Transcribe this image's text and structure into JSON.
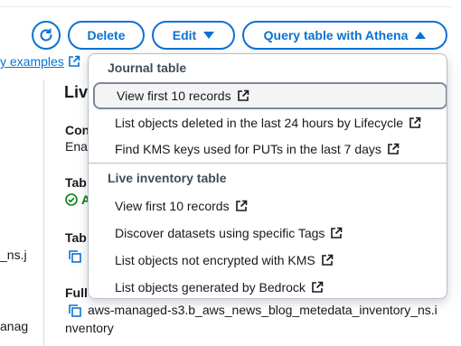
{
  "toolbar": {
    "delete_label": "Delete",
    "edit_label": "Edit",
    "athena_label": "Query table with Athena"
  },
  "background": {
    "examples_link": "y examples",
    "section_title": "Liv",
    "con_label": "Con",
    "enabled_value": "Enal",
    "tab_label_1": "Tab",
    "status_value": "A",
    "tab_label_2": "Tab",
    "left_value_1": "_ns.j",
    "full_label": "Full",
    "left_value_2": "anag",
    "full_value_line1": "aws-managed-s3.b_aws_news_blog_metedata_inventory_ns.i",
    "full_value_line2": "nventory"
  },
  "dropdown": {
    "journal_header": "Journal table",
    "journal_items": [
      "View first 10 records",
      "List objects deleted in the last 24 hours by Lifecycle",
      "Find KMS keys used for PUTs in the last 7 days"
    ],
    "inventory_header": "Live inventory table",
    "inventory_items": [
      "View first 10 records",
      "Discover datasets using specific Tags",
      "List objects not encrypted with KMS",
      "List objects generated by Bedrock"
    ]
  },
  "colors": {
    "accent": "#0972d3",
    "status_green": "#037f0c",
    "border": "#b6bec9"
  },
  "icons": {
    "refresh": "refresh-icon",
    "external": "external-link-icon",
    "copy": "copy-icon",
    "status": "check-circle-icon"
  }
}
